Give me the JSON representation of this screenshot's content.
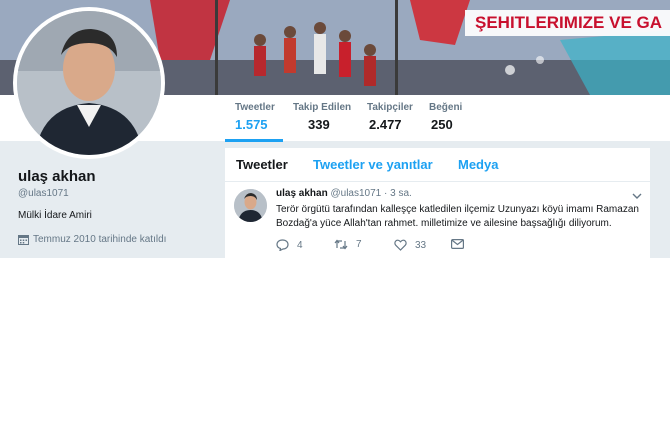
{
  "banner": {
    "caption": "ŞEHITLERIMIZE VE GA"
  },
  "profile": {
    "name": "ulaş akhan",
    "handle": "@ulas1071",
    "bio": "Mülki İdare Amiri",
    "joined": "Temmuz 2010 tarihinde katıldı"
  },
  "stats": [
    {
      "label": "Tweetler",
      "value": "1.575"
    },
    {
      "label": "Takip Edilen",
      "value": "339"
    },
    {
      "label": "Takipçiler",
      "value": "2.477"
    },
    {
      "label": "Beğeni",
      "value": "250"
    }
  ],
  "tabs": [
    {
      "label": "Tweetler"
    },
    {
      "label": "Tweetler ve yanıtlar"
    },
    {
      "label": "Medya"
    }
  ],
  "tweet": {
    "name": "ulaş akhan",
    "meta": "@ulas1071 · 3 sa.",
    "text_line1": "Terör örgütü tarafından kalleşçe katledilen ilçemiz Uzunyazı köyü imamı Ramazan",
    "text_line2": "Bozdağ'a yüce Allah'tan rahmet. milletimize ve ailesine başsağlığı diliyorum.",
    "replies": "4",
    "retweets": "7",
    "likes": "33"
  },
  "icons": {
    "calendar": "calendar-icon",
    "reply": "reply-icon",
    "retweet": "retweet-icon",
    "like": "heart-icon",
    "dm": "envelope-icon",
    "caret": "chevron-down-icon"
  },
  "colors": {
    "accent": "#1da1f2",
    "caption_red": "#c8102e",
    "page_bg": "#e6ecf0"
  }
}
